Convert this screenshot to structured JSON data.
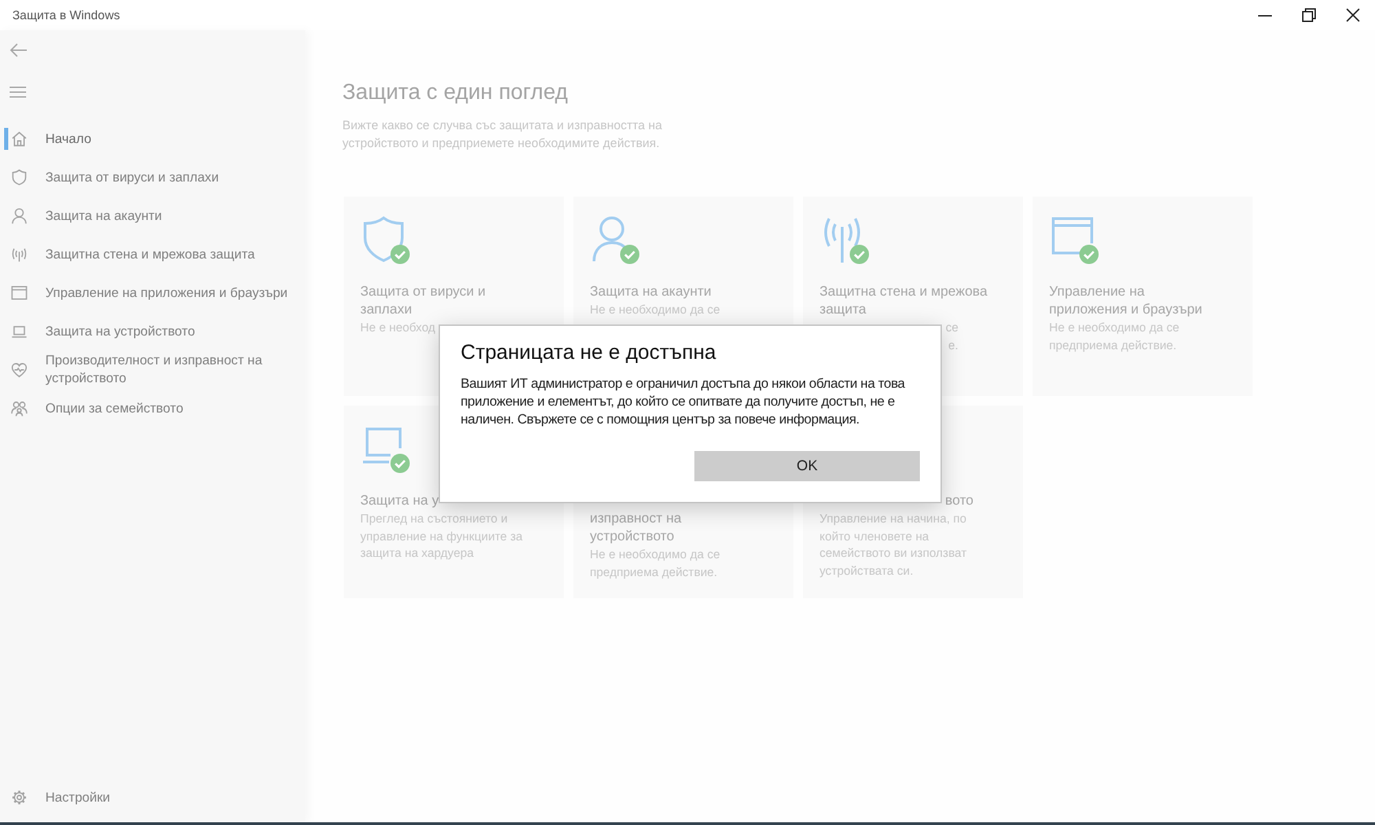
{
  "window": {
    "title": "Защита в Windows"
  },
  "sidebar": {
    "items": [
      {
        "label": "Начало",
        "selected": true
      },
      {
        "label": "Защита от вируси и заплахи",
        "selected": false
      },
      {
        "label": "Защита на акаунти",
        "selected": false
      },
      {
        "label": "Защитна стена и мрежова защита",
        "selected": false
      },
      {
        "label": "Управление на приложения и браузъри",
        "selected": false
      },
      {
        "label": "Защита на устройството",
        "selected": false
      },
      {
        "label": "Производителност и изправност на устройството",
        "selected": false
      },
      {
        "label": "Опции за семейството",
        "selected": false
      }
    ],
    "settings": {
      "label": "Настройки"
    }
  },
  "main": {
    "heading": "Защита с един поглед",
    "description": "Вижте какво се случва със защитата и изправността на устройството и предприемете необходимите действия."
  },
  "cards": [
    {
      "ok": true,
      "title": "Защита от вируси и заплахи",
      "description": "Не е необход"
    },
    {
      "ok": true,
      "title": "Защита на акаунти",
      "description": "Не е необходимо да се"
    },
    {
      "ok": true,
      "title": "Защитна стена и мрежова защита",
      "description_parts": [
        "се",
        "е."
      ]
    },
    {
      "ok": true,
      "title": "Управление на приложения и браузъри",
      "description": "Не е необходимо да се предприема действие."
    },
    {
      "ok": true,
      "title": "Защита на у",
      "description": "Преглед на състоянието и управление на функциите за защита на хардуера"
    },
    {
      "title": "изправност на устройството",
      "description": "Не е необходимо да се предприема действие."
    },
    {
      "title": "вото",
      "description": "Управление на начина, по който членовете на семейството ви използват устройствата си."
    }
  ],
  "dialog": {
    "title": "Страницата не е достъпна",
    "message": "Вашият ИТ администратор е ограничил достъпа до някои области на това приложение и елементът, до който се опитвате да получите достъп, не е наличен. Свържете се с помощния център за повече информация.",
    "button": "OK"
  }
}
